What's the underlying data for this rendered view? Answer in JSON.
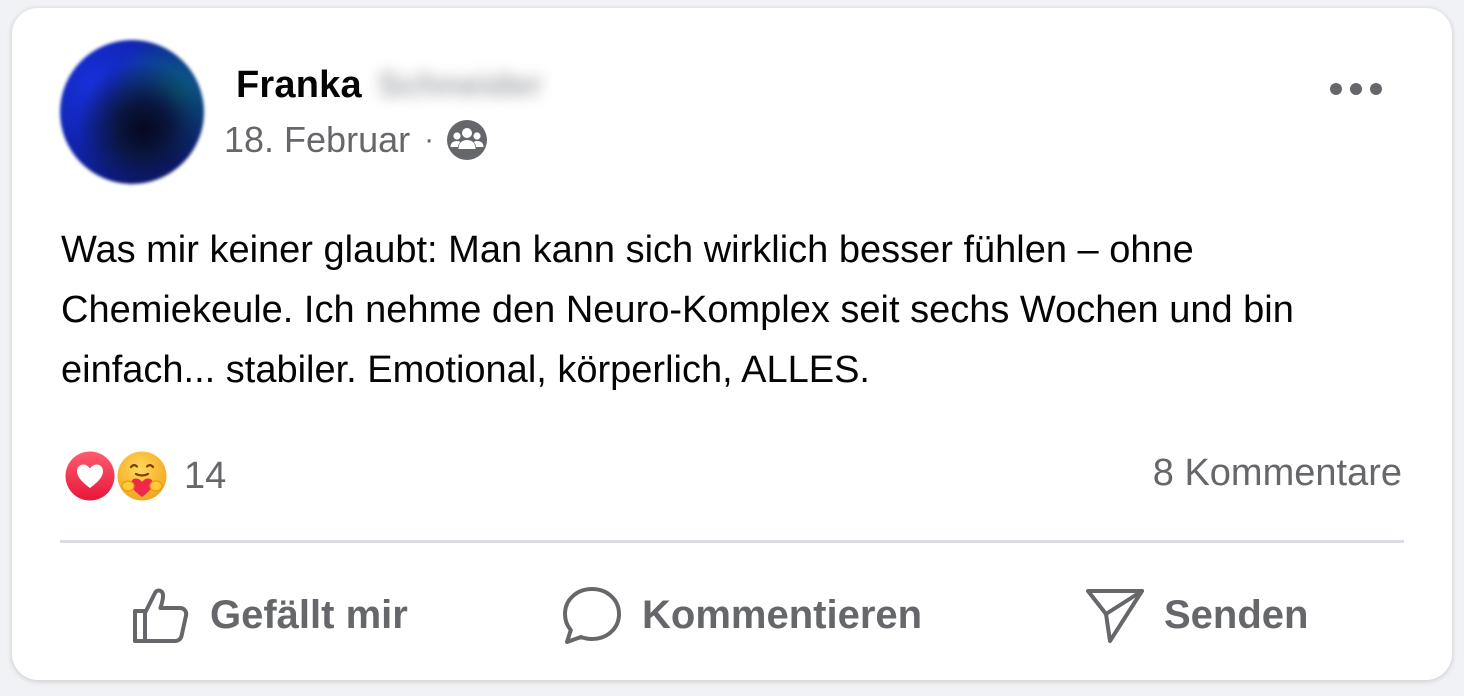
{
  "post": {
    "author_first_name": "Franka",
    "author_last_name": "Schneider",
    "date": "18. Februar",
    "separator": "·",
    "audience_icon": "friends-group-icon",
    "more_icon": "more-horizontal-icon",
    "text": "Was mir keiner glaubt: Man kann sich wirklich besser fühlen – ohne Chemiekeule. Ich nehme den Neuro-Komplex seit sechs Wochen und bin einfach... stabiler. Emotional, körperlich, ALLES."
  },
  "reactions": {
    "icons": [
      "love-reaction-icon",
      "care-reaction-icon"
    ],
    "count": "14",
    "comments_label": "8 Kommentare"
  },
  "actions": {
    "like_label": "Gefällt mir",
    "comment_label": "Kommentieren",
    "send_label": "Senden"
  },
  "colors": {
    "background": "#f0f2f5",
    "card": "#ffffff",
    "primary_text": "#050505",
    "secondary_text": "#65676b",
    "divider": "#dadde1",
    "love_red": "#f0284a",
    "care_yellow": "#f7b125"
  }
}
